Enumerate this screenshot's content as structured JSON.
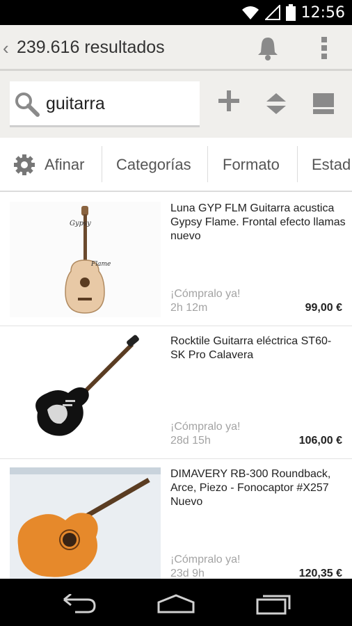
{
  "status_bar": {
    "time": "12:56",
    "icons": [
      "wifi-icon",
      "signal-icon",
      "battery-icon"
    ]
  },
  "action_bar": {
    "title": "239.616 resultados",
    "icons": [
      "chevron-left-icon",
      "bell-icon",
      "overflow-menu-icon"
    ]
  },
  "search": {
    "query": "guitarra",
    "tools": [
      "add-icon",
      "sort-icon",
      "view-toggle-icon"
    ]
  },
  "filters": {
    "tabs": [
      {
        "label": "Afinar",
        "icon": "gear-icon"
      },
      {
        "label": "Categorías"
      },
      {
        "label": "Formato"
      },
      {
        "label": "Estad"
      }
    ]
  },
  "listings": [
    {
      "title": "Luna GYP FLM Guitarra acustica Gypsy Flame. Frontal efecto llamas nuevo",
      "buy_label": "¡Cómpralo ya!",
      "time_left": "2h 12m",
      "price": "99,00 €",
      "thumb_text": [
        "Gypsy",
        "Flame"
      ]
    },
    {
      "title": "Rocktile Guitarra eléctrica ST60-SK Pro Calavera",
      "buy_label": "¡Cómpralo ya!",
      "time_left": "28d 15h",
      "price": "106,00 €"
    },
    {
      "title": "DIMAVERY RB-300 Roundback, Arce, Piezo - Fonocaptor #X257 Nuevo",
      "buy_label": "¡Cómpralo ya!",
      "time_left": "23d 9h",
      "price": "120,35 €"
    }
  ],
  "nav_bar": {
    "icons": [
      "back-icon",
      "home-icon",
      "recents-icon"
    ]
  },
  "colors": {
    "header_bg": "#f0efec",
    "status_bg": "#000000",
    "icon_gray": "#8a8a8a",
    "muted_text": "#a3a3a3"
  }
}
